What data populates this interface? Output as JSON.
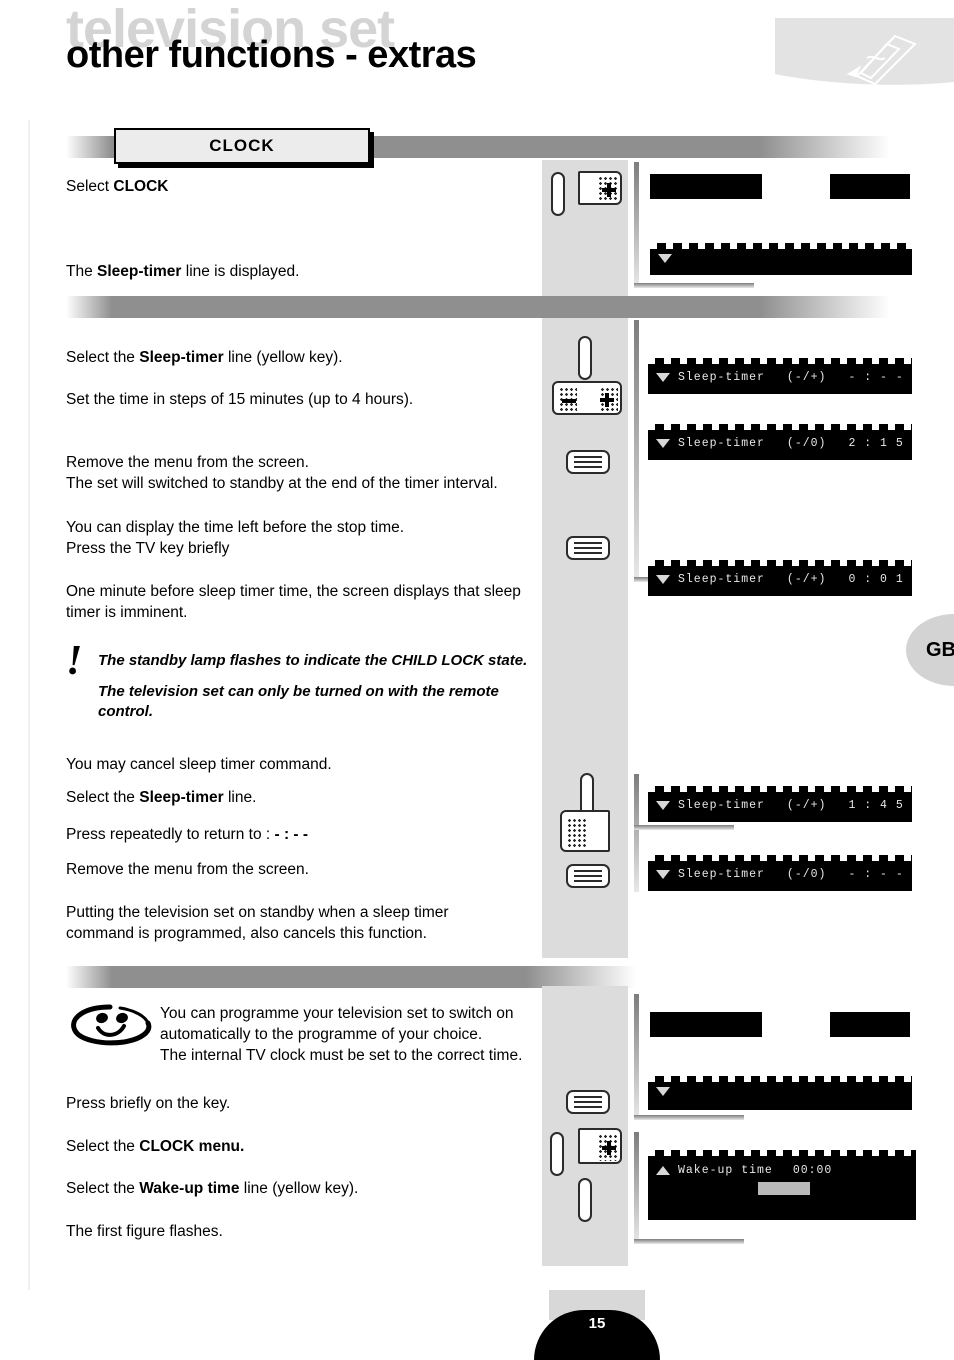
{
  "header": {
    "watermark": "television set",
    "title": "other functions - extras",
    "deco_icon": "remote-control-outline-icon"
  },
  "section_clock": {
    "tab_label": "CLOCK",
    "lines": [
      {
        "text_before": "Select ",
        "bold": "CLOCK",
        "text_after": ""
      },
      {
        "text_before": "The ",
        "bold": "Sleep-timer",
        "text_after": "  line is displayed."
      }
    ],
    "keys": [
      {
        "name": "pill-key",
        "glyph": ""
      },
      {
        "name": "cursor-pad-key",
        "glyph": "plus"
      }
    ],
    "displays": [
      {
        "type": "menu-bar-highlight",
        "value": ""
      },
      {
        "type": "osd-line",
        "arrow": "down",
        "value": ""
      }
    ]
  },
  "section_sleep_timer": {
    "paragraphs": [
      {
        "text_before": "Select the ",
        "bold": "Sleep-timer",
        "text_after": " line (yellow key)."
      },
      {
        "text_before": "Set the time in steps of 15 minutes (up to 4 hours).",
        "bold": "",
        "text_after": ""
      },
      {
        "text_before": "Remove the menu from the screen.",
        "bold": "",
        "text_after": ""
      },
      {
        "text_before": "The set will switched to standby at the end of the timer interval.",
        "bold": "",
        "text_after": ""
      },
      {
        "text_before": "You can display the time left before the stop time.",
        "bold": "",
        "text_after": ""
      },
      {
        "text_before": "Press the TV key briefly",
        "bold": "",
        "text_after": ""
      },
      {
        "text_before": "One minute before sleep timer time, the screen displays that sleep",
        "bold": "",
        "text_after": ""
      },
      {
        "text_before": "timer is imminent.",
        "bold": "",
        "text_after": ""
      }
    ],
    "note": {
      "marker": "!",
      "line1": "The standby lamp flashes to indicate the CHILD LOCK state.",
      "line2": "The television set can only be turned on with the remote",
      "line3": "control."
    },
    "displays": [
      {
        "arrow": "down",
        "label": "Sleep-timer",
        "keys": "(-/+)",
        "value": "- : - -"
      },
      {
        "arrow": "down",
        "label": "Sleep-timer",
        "keys": "(-/0)",
        "value": "2 : 1 5"
      },
      {
        "arrow": "down",
        "label": "Sleep-timer",
        "keys": "(-/+)",
        "value": "0 : 0 1"
      }
    ]
  },
  "section_cancel": {
    "paragraphs": [
      {
        "text_before": "You may cancel sleep timer command.",
        "bold": "",
        "text_after": ""
      },
      {
        "text_before": "Select the ",
        "bold": "Sleep-timer",
        "text_after": " line."
      },
      {
        "text_before": "Press repeatedly to return to :  ",
        "bold": "- : - -",
        "text_after": ""
      },
      {
        "text_before": "Remove the menu from the screen.",
        "bold": "",
        "text_after": ""
      },
      {
        "text_before": "Putting the television set on standby when a sleep timer",
        "bold": "",
        "text_after": ""
      },
      {
        "text_before": "command is programmed, also cancels this function.",
        "bold": "",
        "text_after": ""
      }
    ],
    "displays": [
      {
        "arrow": "down",
        "label": "Sleep-timer",
        "keys": "(-/+)",
        "value": "1 : 4 5"
      },
      {
        "arrow": "down",
        "label": "Sleep-timer",
        "keys": "(-/0)",
        "value": "- : - -"
      }
    ]
  },
  "section_wakeup": {
    "tip": {
      "icon": "smiley-face-icon",
      "line1": "You can programme your television set to switch on",
      "line2": "automatically to the programme of your choice.",
      "line3": "The internal TV clock must be set to the correct time."
    },
    "paragraphs": [
      {
        "text_before": "Press briefly on the key.",
        "bold": "",
        "text_after": ""
      },
      {
        "text_before": "Select the ",
        "bold": "CLOCK",
        "text_after": " menu."
      },
      {
        "text_before": "Select the ",
        "bold": "Wake-up time",
        "text_after": " line (yellow key)."
      },
      {
        "text_before": "The first figure flashes.",
        "bold": "",
        "text_after": ""
      }
    ],
    "displays": [
      {
        "type": "menu-bar-highlight",
        "value": ""
      },
      {
        "type": "osd-line",
        "arrow": "down",
        "value": ""
      },
      {
        "type": "osd-line",
        "arrow": "up",
        "label": "Wake-up time",
        "value": "00:00"
      }
    ]
  },
  "sidebar": {
    "language_tab": "GB"
  },
  "footer": {
    "page_number": "15"
  },
  "colors": {
    "section_bar": "#8f8f8f",
    "key_column": "#dcdcdc",
    "tab_background": "#ececec",
    "watermark": "#d4d4d4",
    "osd_background": "#000000",
    "osd_text": "#e8e8e8"
  }
}
